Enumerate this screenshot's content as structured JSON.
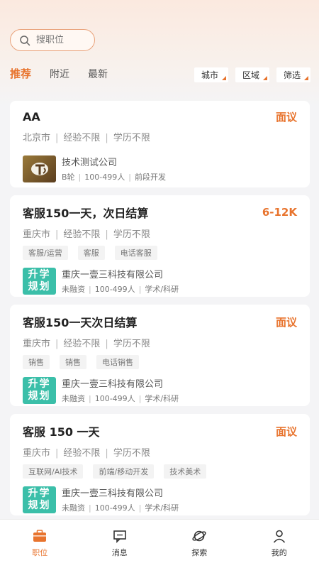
{
  "search": {
    "placeholder": "搜职位"
  },
  "tabs": [
    {
      "label": "推荐",
      "active": true
    },
    {
      "label": "附近",
      "active": false
    },
    {
      "label": "最新",
      "active": false
    }
  ],
  "filters": [
    {
      "label": "城市"
    },
    {
      "label": "区域"
    },
    {
      "label": "筛选"
    }
  ],
  "jobs": [
    {
      "title": "AA",
      "salary": "面议",
      "city": "北京市",
      "experience": "经验不限",
      "education": "学历不限",
      "tags": [],
      "company": {
        "name": "技术测试公司",
        "funding": "B轮",
        "size": "100-499人",
        "industry": "前段开发"
      }
    },
    {
      "title": "客服150一天，次日结算",
      "salary": "6-12K",
      "city": "重庆市",
      "experience": "经验不限",
      "education": "学历不限",
      "tags": [
        "客服/运营",
        "客服",
        "电话客服"
      ],
      "company": {
        "name": "重庆一壹三科技有限公司",
        "funding": "未融资",
        "size": "100-499人",
        "industry": "学术/科研",
        "logo_line1": "升学",
        "logo_line2": "规划"
      }
    },
    {
      "title": "客服150一天次日结算",
      "salary": "面议",
      "city": "重庆市",
      "experience": "经验不限",
      "education": "学历不限",
      "tags": [
        "销售",
        "销售",
        "电话销售"
      ],
      "company": {
        "name": "重庆一壹三科技有限公司",
        "funding": "未融资",
        "size": "100-499人",
        "industry": "学术/科研",
        "logo_line1": "升学",
        "logo_line2": "规划"
      }
    },
    {
      "title": "客服 150 一天",
      "salary": "面议",
      "city": "重庆市",
      "experience": "经验不限",
      "education": "学历不限",
      "tags": [
        "互联网/AI技术",
        "前端/移动开发",
        "技术美术"
      ],
      "company": {
        "name": "重庆一壹三科技有限公司",
        "funding": "未融资",
        "size": "100-499人",
        "industry": "学术/科研",
        "logo_line1": "升学",
        "logo_line2": "规划"
      }
    }
  ],
  "nav": [
    {
      "label": "职位",
      "icon": "briefcase-icon",
      "active": true
    },
    {
      "label": "消息",
      "icon": "message-icon",
      "active": false
    },
    {
      "label": "探索",
      "icon": "planet-icon",
      "active": false
    },
    {
      "label": "我的",
      "icon": "person-icon",
      "active": false
    }
  ],
  "colors": {
    "accent": "#e8742e",
    "teal_logo": "#3bbfa9"
  }
}
